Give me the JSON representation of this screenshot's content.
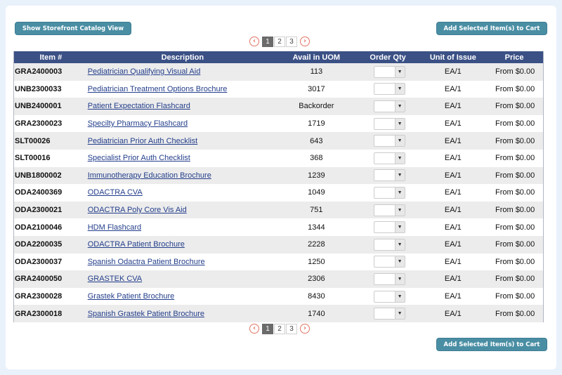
{
  "buttons": {
    "storefront": "Show Storefront Catalog View",
    "add_to_cart": "Add Selected Item(s) to Cart"
  },
  "pager": {
    "prev_icon": "chevron-left-icon",
    "next_icon": "chevron-right-icon",
    "pages": [
      "1",
      "2",
      "3"
    ],
    "current": "1"
  },
  "table": {
    "headers": {
      "item": "Item #",
      "description": "Description",
      "avail": "Avail in UOM",
      "qty": "Order Qty",
      "unit": "Unit of Issue",
      "price": "Price"
    },
    "rows": [
      {
        "item": "GRA2400003",
        "description": "Pediatrician Qualifying Visual Aid",
        "avail": "113",
        "unit": "EA/1",
        "price": "From $0.00"
      },
      {
        "item": "UNB2300033",
        "description": "Pediatrician Treatment Options Brochure",
        "avail": "3017",
        "unit": "EA/1",
        "price": "From $0.00"
      },
      {
        "item": "UNB2400001",
        "description": "Patient Expectation Flashcard",
        "avail": "Backorder",
        "unit": "EA/1",
        "price": "From $0.00"
      },
      {
        "item": "GRA2300023",
        "description": "Specilty Pharmacy Flashcard",
        "avail": "1719",
        "unit": "EA/1",
        "price": "From $0.00"
      },
      {
        "item": "SLT00026",
        "description": "Pediatrician Prior Auth Checklist",
        "avail": "643",
        "unit": "EA/1",
        "price": "From $0.00"
      },
      {
        "item": "SLT00016",
        "description": "Specialist Prior Auth Checklist",
        "avail": "368",
        "unit": "EA/1",
        "price": "From $0.00"
      },
      {
        "item": "UNB1800002",
        "description": "Immunotherapy Education Brochure",
        "avail": "1239",
        "unit": "EA/1",
        "price": "From $0.00"
      },
      {
        "item": "ODA2400369",
        "description": "ODACTRA CVA",
        "avail": "1049",
        "unit": "EA/1",
        "price": "From $0.00"
      },
      {
        "item": "ODA2300021",
        "description": "ODACTRA Poly Core Vis Aid",
        "avail": "751",
        "unit": "EA/1",
        "price": "From $0.00"
      },
      {
        "item": "ODA2100046",
        "description": "HDM Flashcard",
        "avail": "1344",
        "unit": "EA/1",
        "price": "From $0.00"
      },
      {
        "item": "ODA2200035",
        "description": "ODACTRA Patient Brochure",
        "avail": "2228",
        "unit": "EA/1",
        "price": "From $0.00"
      },
      {
        "item": "ODA2300037",
        "description": "Spanish Odactra Patient Brochure",
        "avail": "1250",
        "unit": "EA/1",
        "price": "From $0.00"
      },
      {
        "item": "GRA2400050",
        "description": "GRASTEK CVA",
        "avail": "2306",
        "unit": "EA/1",
        "price": "From $0.00"
      },
      {
        "item": "GRA2300028",
        "description": "Grastek Patient Brochure",
        "avail": "8430",
        "unit": "EA/1",
        "price": "From $0.00"
      },
      {
        "item": "GRA2300018",
        "description": "Spanish Grastek Patient Brochure",
        "avail": "1740",
        "unit": "EA/1",
        "price": "From $0.00"
      }
    ]
  },
  "colors": {
    "header_bg": "#3b5186",
    "button_bg": "#4a8ea4",
    "link": "#233e8b",
    "pager_arrow": "#e37564"
  }
}
